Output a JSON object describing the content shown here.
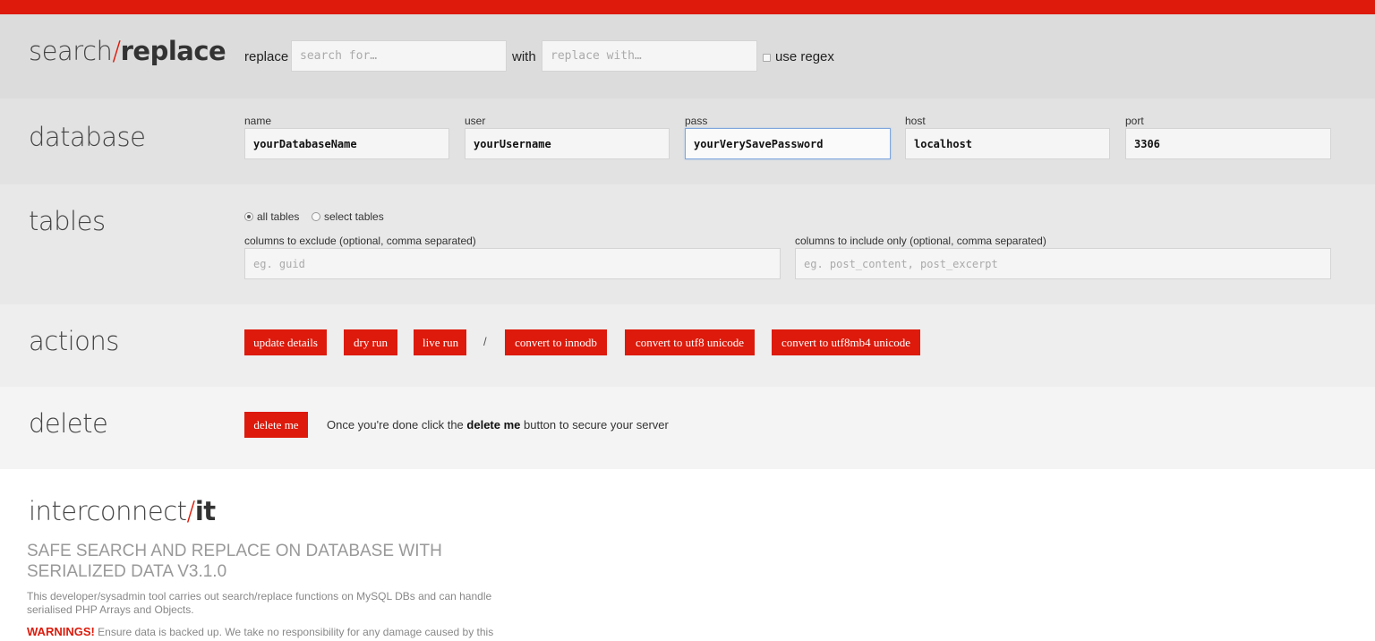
{
  "brand": {
    "part1": "search",
    "slash": "/",
    "part2": "replace"
  },
  "search_replace": {
    "replace_label": "replace",
    "search_placeholder": "search for…",
    "with_label": "with",
    "replace_placeholder": "replace with…",
    "regex_label": "use regex"
  },
  "database": {
    "title": "database",
    "fields": {
      "name": {
        "label": "name",
        "value": "yourDatabaseName"
      },
      "user": {
        "label": "user",
        "value": "yourUsername"
      },
      "pass": {
        "label": "pass",
        "value": "yourVerySavePassword"
      },
      "host": {
        "label": "host",
        "value": "localhost"
      },
      "port": {
        "label": "port",
        "value": "3306"
      }
    }
  },
  "tables": {
    "title": "tables",
    "all_label": "all tables",
    "select_label": "select tables",
    "exclude_label": "columns to exclude (optional, comma separated)",
    "exclude_placeholder": "eg. guid",
    "include_label": "columns to include only (optional, comma separated)",
    "include_placeholder": "eg. post_content, post_excerpt"
  },
  "actions": {
    "title": "actions",
    "update": "update details",
    "dry_run": "dry run",
    "live_run": "live run",
    "separator": "/",
    "innodb": "convert to innodb",
    "utf8": "convert to utf8 unicode",
    "utf8mb4": "convert to utf8mb4 unicode"
  },
  "delete": {
    "title": "delete",
    "button": "delete me",
    "text_before": "Once you're done click the ",
    "text_bold": "delete me",
    "text_after": " button to secure your server"
  },
  "info": {
    "brand_part1": "interconnect",
    "brand_slash": "/",
    "brand_part2": "it",
    "heading": "SAFE SEARCH AND REPLACE ON DATABASE WITH SERIALIZED DATA V3.1.0",
    "description": "This developer/sysadmin tool carries out search/replace functions on MySQL DBs and can handle serialised PHP Arrays and Objects.",
    "warning_label": "WARNINGS!",
    "warning_text": " Ensure data is backed up. We take no responsibility for any damage caused by this"
  },
  "colors": {
    "accent": "#dd1a0b"
  }
}
